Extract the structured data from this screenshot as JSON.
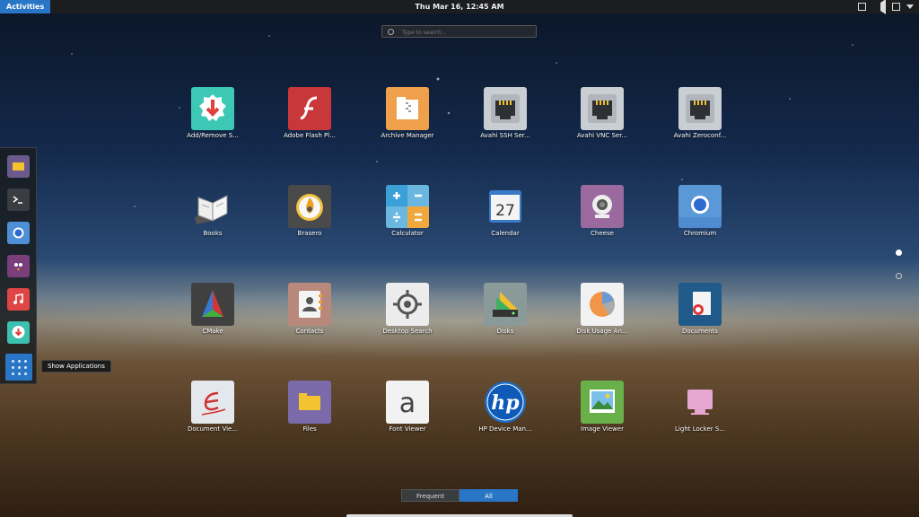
{
  "topbar": {
    "activities": "Activities",
    "clock": "Thu Mar 16, 12:45 AM"
  },
  "search": {
    "placeholder": "Type to search..."
  },
  "dock": {
    "items": [
      "files",
      "terminal",
      "chromium",
      "pidgin",
      "music",
      "software"
    ],
    "tooltip": "Show Applications"
  },
  "apps": [
    {
      "label": "Add/Remove S...",
      "icon": "software-icon"
    },
    {
      "label": "Adobe Flash Pl...",
      "icon": "flash-icon"
    },
    {
      "label": "Archive Manager",
      "icon": "archive-icon"
    },
    {
      "label": "Avahi SSH Ser...",
      "icon": "network-port-icon"
    },
    {
      "label": "Avahi VNC Ser...",
      "icon": "network-port-icon"
    },
    {
      "label": "Avahi Zeroconf...",
      "icon": "network-port-icon"
    },
    {
      "label": "Books",
      "icon": "book-icon"
    },
    {
      "label": "Brasero",
      "icon": "disc-burner-icon"
    },
    {
      "label": "Calculator",
      "icon": "calculator-icon"
    },
    {
      "label": "Calendar",
      "icon": "calendar-icon",
      "day": "27"
    },
    {
      "label": "Cheese",
      "icon": "webcam-icon"
    },
    {
      "label": "Chromium",
      "icon": "chromium-icon"
    },
    {
      "label": "CMake",
      "icon": "cmake-icon"
    },
    {
      "label": "Contacts",
      "icon": "contacts-icon"
    },
    {
      "label": "Desktop Search",
      "icon": "search-target-icon"
    },
    {
      "label": "Disks",
      "icon": "disks-icon"
    },
    {
      "label": "Disk Usage An...",
      "icon": "pie-chart-icon"
    },
    {
      "label": "Documents",
      "icon": "documents-icon"
    },
    {
      "label": "Document Vie...",
      "icon": "document-viewer-icon"
    },
    {
      "label": "Files",
      "icon": "folder-icon"
    },
    {
      "label": "Font Viewer",
      "icon": "font-icon",
      "glyph": "a"
    },
    {
      "label": "HP Device Man...",
      "icon": "hp-logo-icon",
      "glyph": "hp"
    },
    {
      "label": "Image Viewer",
      "icon": "image-icon"
    },
    {
      "label": "Light Locker S...",
      "icon": "light-locker-icon"
    }
  ],
  "switcher": {
    "frequent": "Frequent",
    "all": "All"
  }
}
